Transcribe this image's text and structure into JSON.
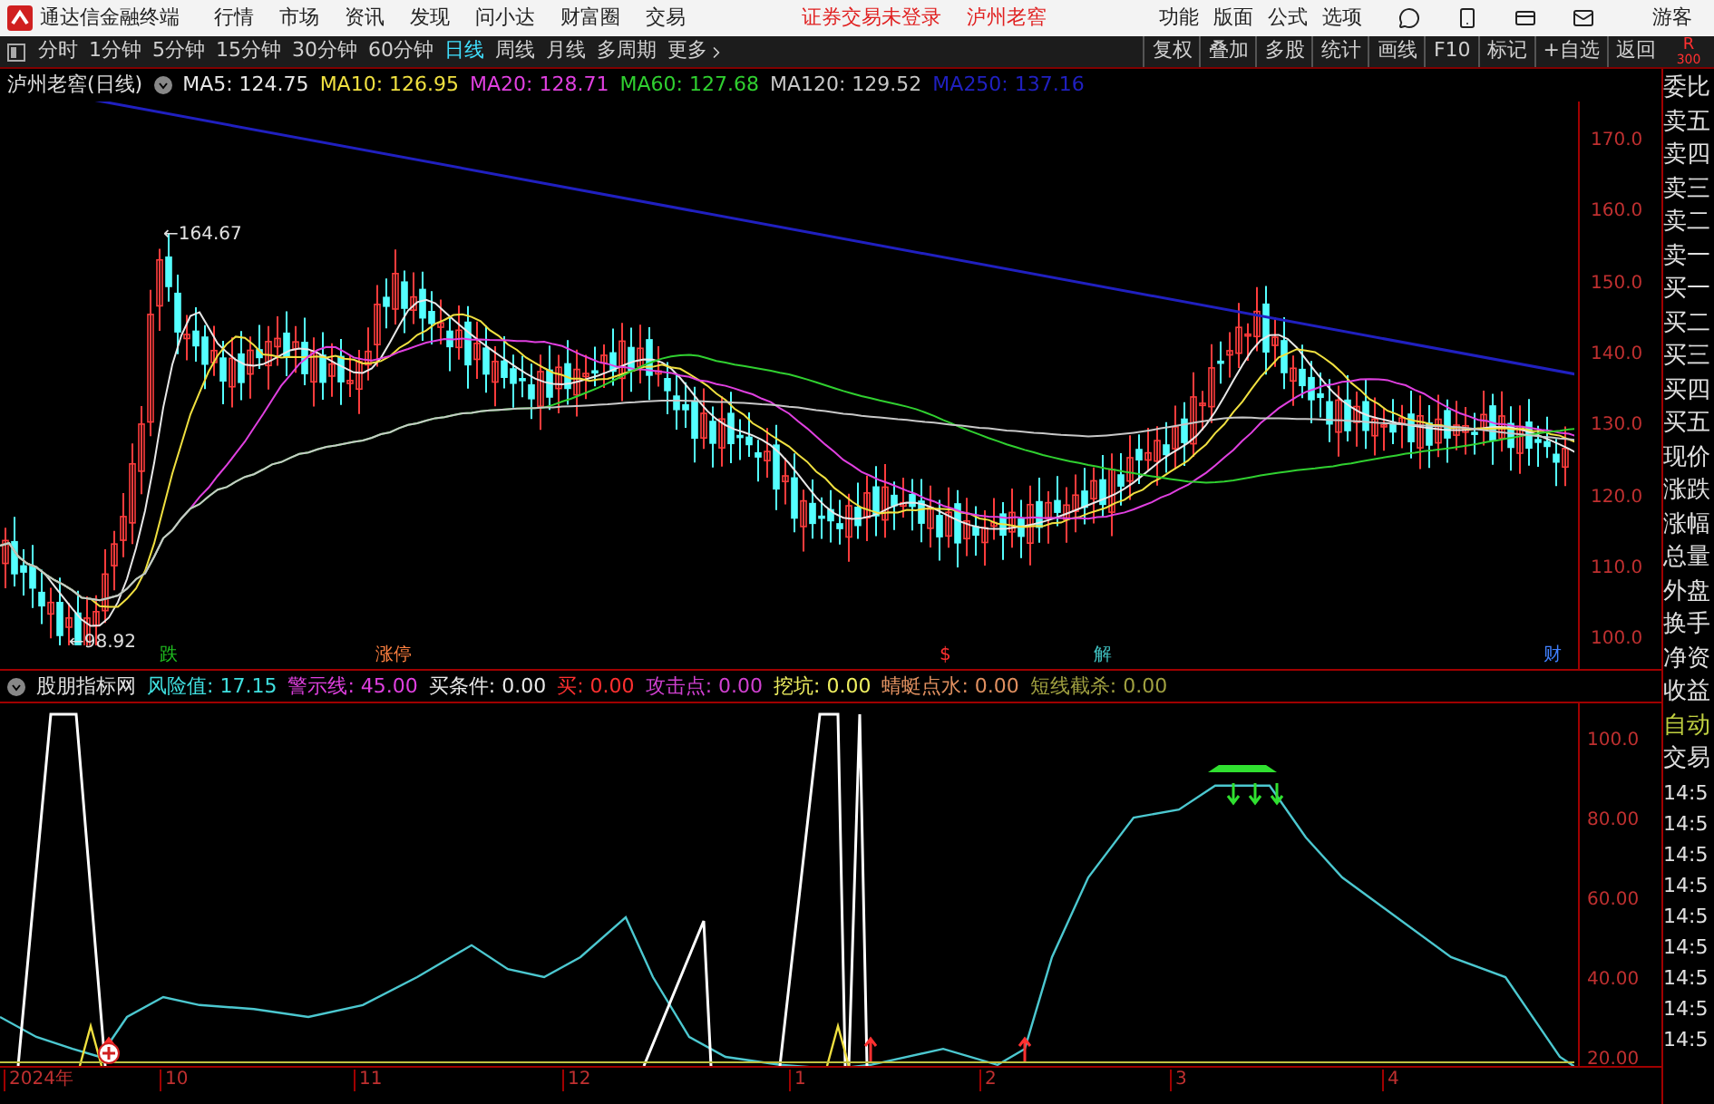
{
  "menubar": {
    "app_title": "通达信金融终端",
    "menus": [
      "行情",
      "市场",
      "资讯",
      "发现",
      "问小达",
      "财富圈",
      "交易"
    ],
    "notice": "证券交易未登录",
    "stock": "泸州老窖",
    "right_menus": [
      "功能",
      "版面",
      "公式",
      "选项"
    ],
    "user": "游客"
  },
  "toolbar": {
    "periods": [
      {
        "label": "分时",
        "selected": false
      },
      {
        "label": "1分钟",
        "selected": false
      },
      {
        "label": "5分钟",
        "selected": false
      },
      {
        "label": "15分钟",
        "selected": false
      },
      {
        "label": "30分钟",
        "selected": false
      },
      {
        "label": "60分钟",
        "selected": false
      },
      {
        "label": "日线",
        "selected": true
      },
      {
        "label": "周线",
        "selected": false
      },
      {
        "label": "月线",
        "selected": false
      },
      {
        "label": "多周期",
        "selected": false
      }
    ],
    "more": "更多",
    "actions": [
      "复权",
      "叠加",
      "多股",
      "统计",
      "画线",
      "F10",
      "标记",
      "+自选",
      "返回"
    ],
    "corner": [
      "R",
      "300"
    ]
  },
  "chart_header": {
    "title": "泸州老窖(日线)",
    "ma": [
      {
        "label": "MA5: 124.75",
        "color": "#e8e8e8"
      },
      {
        "label": "MA10: 126.95",
        "color": "#f0e040"
      },
      {
        "label": "MA20: 128.71",
        "color": "#e040e0"
      },
      {
        "label": "MA60: 127.68",
        "color": "#30d030"
      },
      {
        "label": "MA120: 129.52",
        "color": "#c8c8c8"
      },
      {
        "label": "MA250: 137.16",
        "color": "#2020c0"
      }
    ]
  },
  "main_chart": {
    "yticks": [
      "170.0",
      "160.0",
      "150.0",
      "140.0",
      "130.0",
      "120.0",
      "110.0",
      "100.0"
    ],
    "high_label": "←164.67",
    "low_label": "←98.92",
    "markers": [
      {
        "label": "跌",
        "color": "#20c020"
      },
      {
        "label": "涨停",
        "color": "#ff8040"
      },
      {
        "label": "$",
        "color": "#ff3030"
      },
      {
        "label": "解",
        "color": "#40c0c0"
      },
      {
        "label": "财",
        "color": "#4080ff"
      }
    ]
  },
  "indicator": {
    "name": "股朋指标网",
    "values": [
      {
        "label": "风险值: 17.15",
        "color": "#40e0e0"
      },
      {
        "label": "警示线: 45.00",
        "color": "#e040e0"
      },
      {
        "label": "买条件: 0.00",
        "color": "#e8e8e8"
      },
      {
        "label": "买: 0.00",
        "color": "#ff3030"
      },
      {
        "label": "攻击点: 0.00",
        "color": "#d040d0"
      },
      {
        "label": "挖坑: 0.00",
        "color": "#f0f060"
      },
      {
        "label": "蜻蜓点水: 0.00",
        "color": "#e09060"
      },
      {
        "label": "短线截杀: 0.00",
        "color": "#a0a040"
      }
    ],
    "yticks": [
      "100.0",
      "80.00",
      "60.00",
      "40.00",
      "20.00"
    ]
  },
  "date_axis": [
    "2024年",
    "10",
    "11",
    "12",
    "1",
    "2",
    "3",
    "4"
  ],
  "side_panel": {
    "items": [
      {
        "label": "委比",
        "color": "#e0e0e0"
      },
      {
        "label": "卖五",
        "color": "#e0e0e0"
      },
      {
        "label": "卖四",
        "color": "#e0e0e0"
      },
      {
        "label": "卖三",
        "color": "#e0e0e0"
      },
      {
        "label": "卖二",
        "color": "#e0e0e0"
      },
      {
        "label": "卖一",
        "color": "#e0e0e0"
      },
      {
        "label": "买一",
        "color": "#e0e0e0"
      },
      {
        "label": "买二",
        "color": "#e0e0e0"
      },
      {
        "label": "买三",
        "color": "#e0e0e0"
      },
      {
        "label": "买四",
        "color": "#e0e0e0"
      },
      {
        "label": "买五",
        "color": "#e0e0e0"
      },
      {
        "label": "现价",
        "color": "#e0e0e0"
      },
      {
        "label": "涨跌",
        "color": "#e0e0e0"
      },
      {
        "label": "涨幅",
        "color": "#e0e0e0"
      },
      {
        "label": "总量",
        "color": "#e0e0e0"
      },
      {
        "label": "外盘",
        "color": "#e0e0e0"
      },
      {
        "label": "换手",
        "color": "#e0e0e0"
      },
      {
        "label": "净资",
        "color": "#e0e0e0"
      },
      {
        "label": "收益",
        "color": "#e0e0e0"
      },
      {
        "label": "自动",
        "color": "#c0d040"
      },
      {
        "label": "交易",
        "color": "#e0e0e0"
      }
    ],
    "times": [
      "14:5",
      "14:5",
      "14:5",
      "14:5",
      "14:5",
      "14:5",
      "14:5",
      "14:5",
      "14:5"
    ]
  }
}
